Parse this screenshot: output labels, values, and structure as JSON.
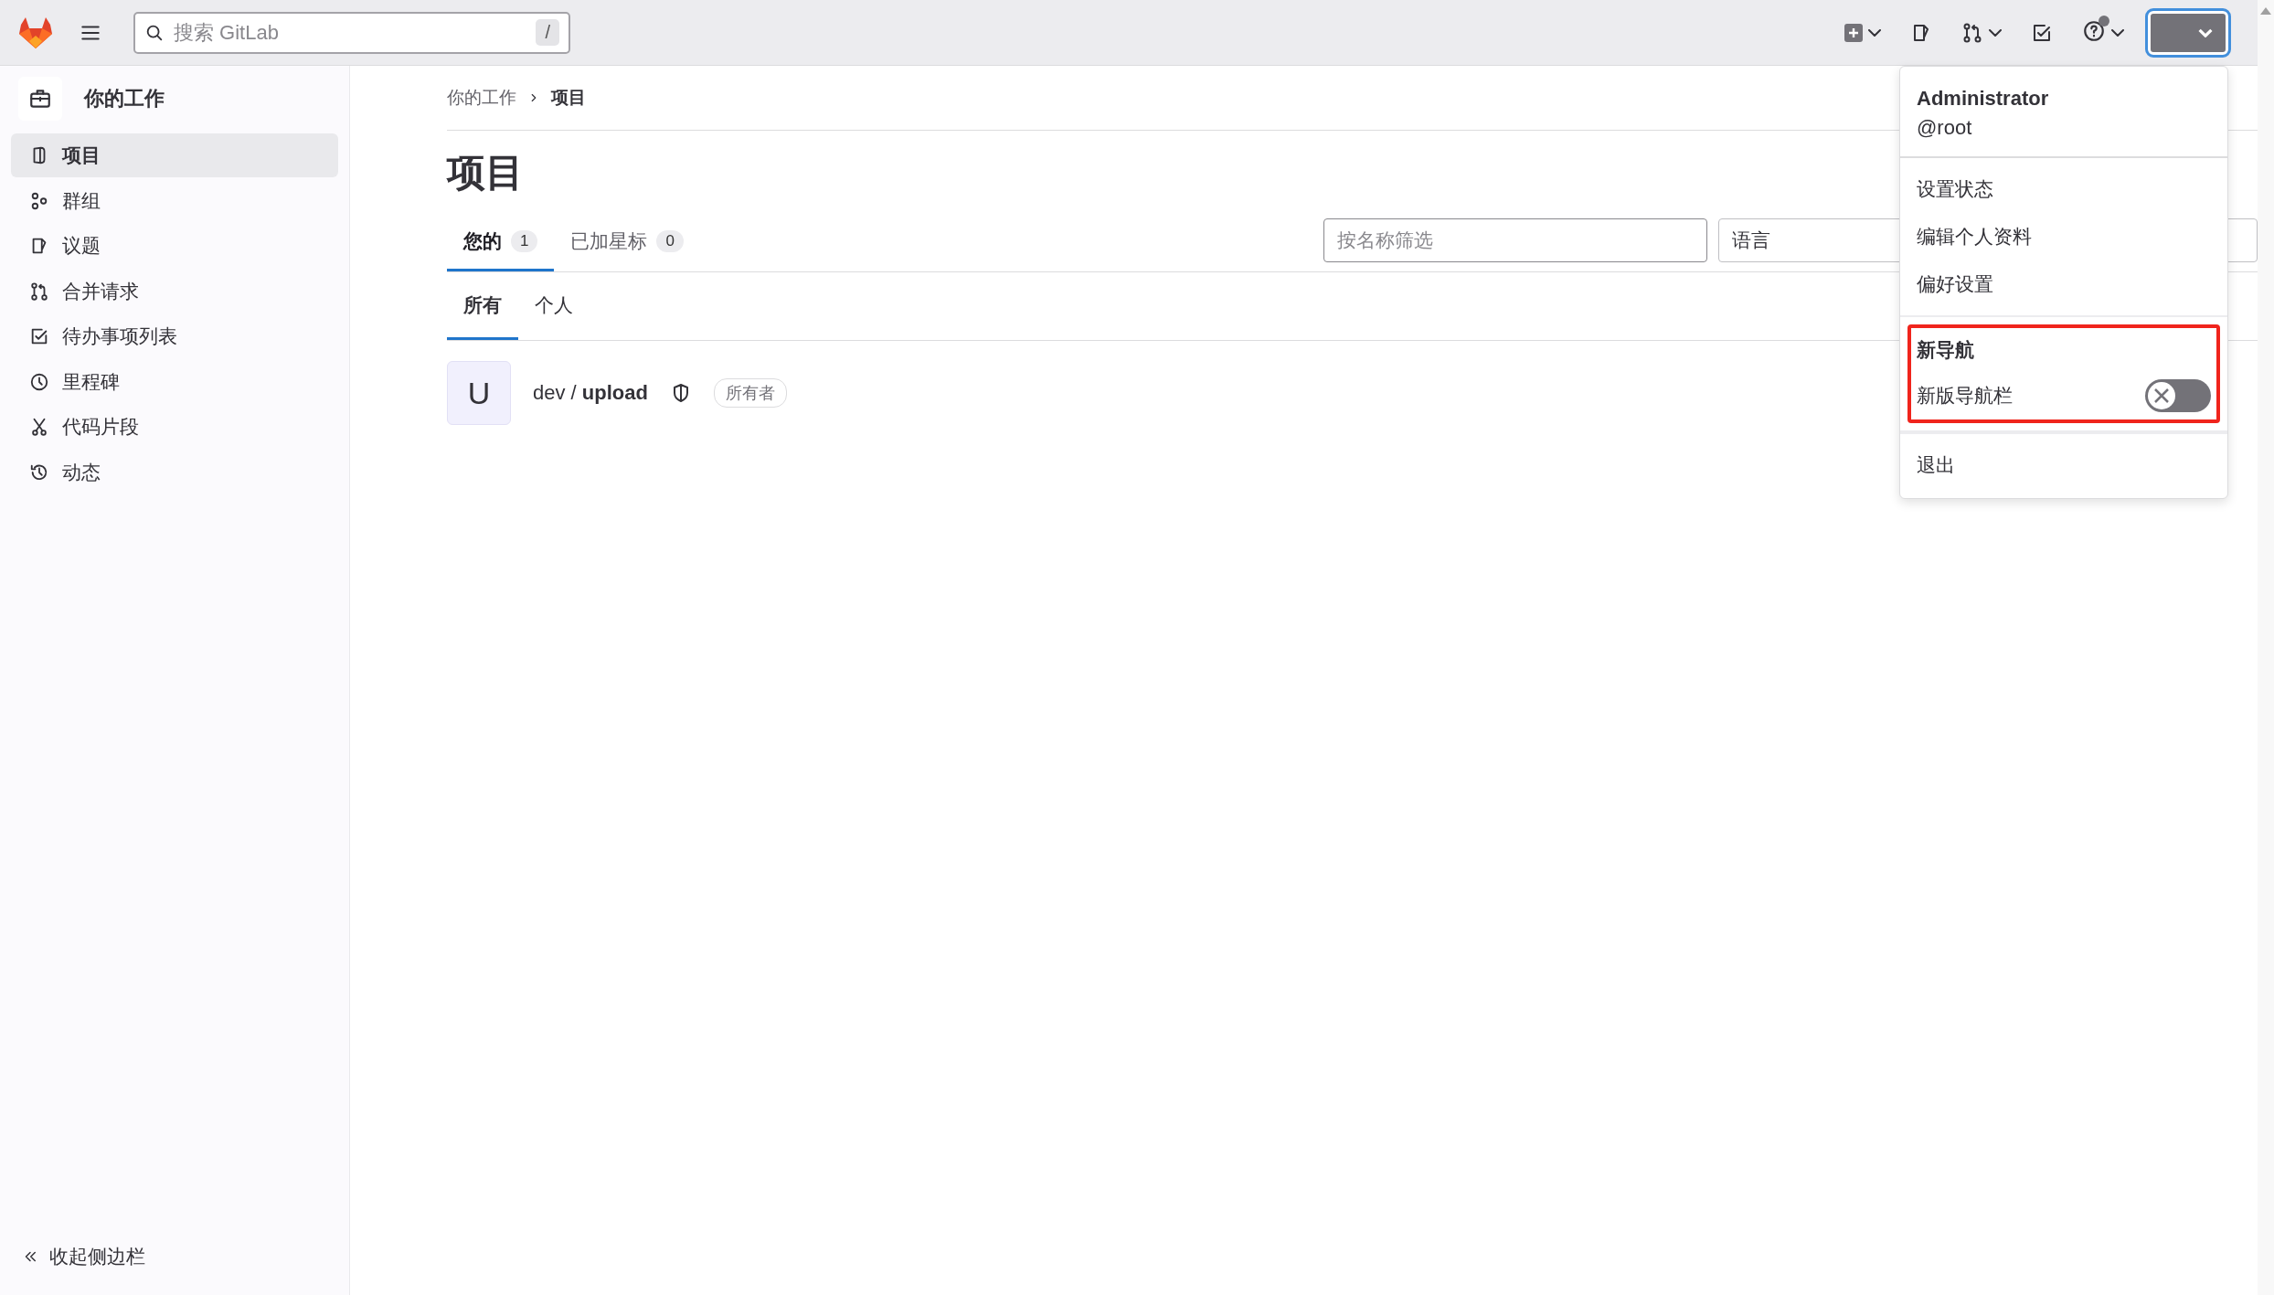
{
  "topbar": {
    "search": {
      "placeholder": "搜索 GitLab",
      "shortcut": "/"
    }
  },
  "sidebar": {
    "title": "你的工作",
    "items": [
      {
        "label": "项目",
        "kind": "project",
        "selected": true
      },
      {
        "label": "群组",
        "kind": "group",
        "selected": false
      },
      {
        "label": "议题",
        "kind": "issue",
        "selected": false
      },
      {
        "label": "合并请求",
        "kind": "merge",
        "selected": false
      },
      {
        "label": "待办事项列表",
        "kind": "todo",
        "selected": false
      },
      {
        "label": "里程碑",
        "kind": "milestone",
        "selected": false
      },
      {
        "label": "代码片段",
        "kind": "snippet",
        "selected": false
      },
      {
        "label": "动态",
        "kind": "activity",
        "selected": false
      }
    ],
    "collapse": "收起侧边栏"
  },
  "breadcrumb": [
    "你的工作",
    "项目"
  ],
  "title": "项目",
  "tabs": [
    {
      "label": "您的",
      "count": "1",
      "selected": true
    },
    {
      "label": "已加星标",
      "count": "0",
      "selected": false
    }
  ],
  "filter": {
    "placeholder": "按名称筛选"
  },
  "language": {
    "value": "语言"
  },
  "subtabs": [
    {
      "label": "所有",
      "selected": true
    },
    {
      "label": "个人",
      "selected": false
    }
  ],
  "projects": [
    {
      "avatar": "U",
      "path": "dev / **upload**",
      "role": "所有者"
    }
  ],
  "user_menu": {
    "name": "Administrator",
    "username": "@root",
    "items": [
      "设置状态",
      "编辑个人资料",
      "偏好设置"
    ],
    "nav_section": {
      "title": "新导航",
      "toggle_label": "新版导航栏",
      "on": false,
      "highlighted": true
    },
    "sign_out": "退出"
  }
}
